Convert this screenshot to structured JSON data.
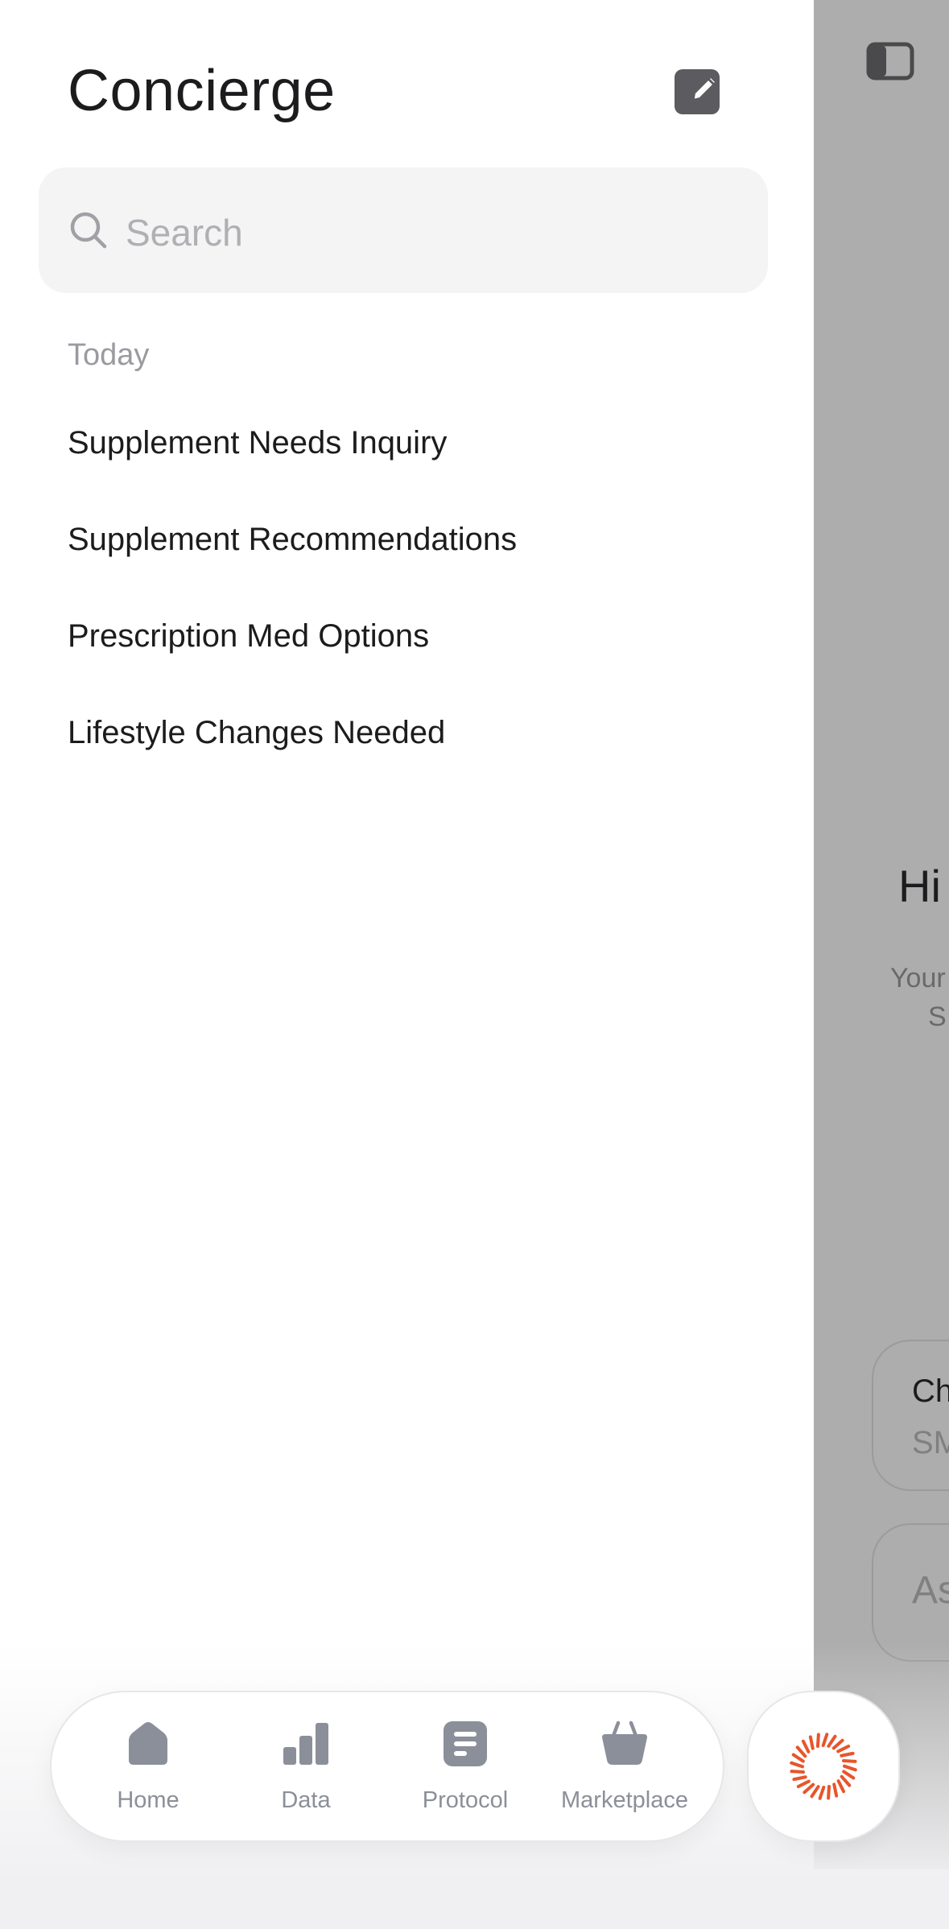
{
  "main": {
    "sidebar_toggle_icon": "sidebar-toggle-icon",
    "greeting": "Hi",
    "subtitle_line1": "Your",
    "subtitle_line2": "S",
    "card1_title": "Ch",
    "card1_sub": "SM",
    "ask_placeholder": "As"
  },
  "drawer": {
    "title": "Concierge",
    "compose_icon": "compose-icon",
    "search": {
      "placeholder": "Search",
      "icon": "search-icon"
    },
    "section_today": "Today",
    "items": [
      {
        "label": "Supplement Needs Inquiry"
      },
      {
        "label": "Supplement Recommendations"
      },
      {
        "label": "Prescription Med Options"
      },
      {
        "label": "Lifestyle Changes Needed"
      }
    ]
  },
  "tabbar": {
    "tabs": [
      {
        "label": "Home",
        "icon": "home-icon"
      },
      {
        "label": "Data",
        "icon": "bar-chart-icon"
      },
      {
        "label": "Protocol",
        "icon": "document-icon"
      },
      {
        "label": "Marketplace",
        "icon": "basket-icon"
      }
    ],
    "fab_icon": "sunburst-icon"
  },
  "colors": {
    "accent": "#e8552b",
    "icon_gray": "#8b8f99",
    "overlay": "#adadad"
  }
}
